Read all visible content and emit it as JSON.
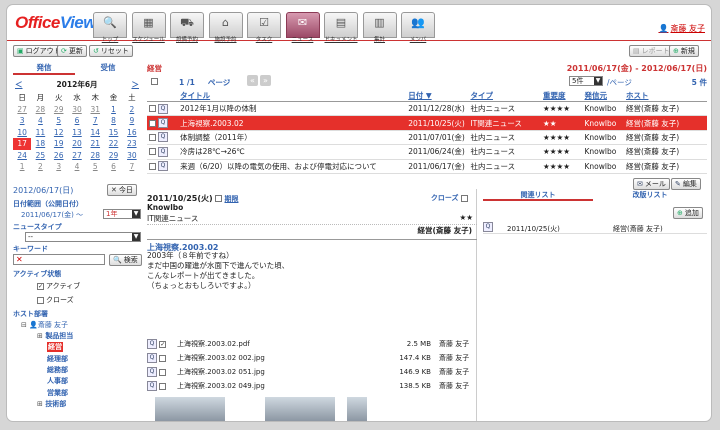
{
  "app": {
    "logo_a": "Office",
    "logo_b": "View"
  },
  "nav": [
    {
      "label": "トップ",
      "icon": "magnifier-icon"
    },
    {
      "label": "スケジュール",
      "icon": "calendar-icon"
    },
    {
      "label": "設備予約",
      "icon": "car-icon"
    },
    {
      "label": "施設予約",
      "icon": "building-icon"
    },
    {
      "label": "タスク",
      "icon": "checklist-icon"
    },
    {
      "label": "ニュース",
      "icon": "ticket-icon"
    },
    {
      "label": "ドキュメント",
      "icon": "document-icon"
    },
    {
      "label": "集計",
      "icon": "book-icon"
    },
    {
      "label": "メンバ",
      "icon": "members-icon"
    }
  ],
  "user": {
    "name": "斎藤 友子"
  },
  "toolbar": {
    "logout": "ログアウト",
    "refresh": "更新",
    "reset": "リセット",
    "report": "レポート",
    "new": "新規"
  },
  "left": {
    "tabs": [
      "発信",
      "受信"
    ],
    "calendar": {
      "prev": "＜",
      "next": "＞",
      "title": "2012年6月",
      "dow": [
        "日",
        "月",
        "火",
        "水",
        "木",
        "金",
        "土"
      ],
      "weeks": [
        [
          "27",
          "28",
          "29",
          "30",
          "31",
          "1",
          "2"
        ],
        [
          "3",
          "4",
          "5",
          "6",
          "7",
          "8",
          "9"
        ],
        [
          "10",
          "11",
          "12",
          "13",
          "14",
          "15",
          "16"
        ],
        [
          "17",
          "18",
          "19",
          "20",
          "21",
          "22",
          "23"
        ],
        [
          "24",
          "25",
          "26",
          "27",
          "28",
          "29",
          "30"
        ],
        [
          "1",
          "2",
          "3",
          "4",
          "5",
          "6",
          "7"
        ]
      ]
    },
    "selected_date": "2012/06/17(日)",
    "today_btn": "今日",
    "range_label": "日付範囲（公開日付）",
    "range_from": "2011/06/17(金) ～",
    "range_len": "1年",
    "newstype_label": "ニュースタイプ",
    "newstype_value": "--",
    "keyword_label": "キーワード",
    "search_btn": "検索",
    "active_label": "アクティブ状態",
    "active_opt": "アクティブ",
    "close_opt": "クローズ",
    "host_label": "ホスト部署",
    "host_user": "斎藤 友子",
    "tree": [
      "製品担当",
      "経営",
      "経理部",
      "総務部",
      "人事部",
      "営業部",
      "技術部"
    ]
  },
  "main": {
    "section": "経営",
    "date_range": "2011/06/17(金) - 2012/06/17(日)",
    "page_info": "1 /1",
    "page_word": "ページ",
    "per_page": "5件",
    "per_page_suffix": "/ページ",
    "count": "5 件",
    "headers": [
      "タイトル",
      "日付 ▼",
      "タイプ",
      "重要度",
      "発信元",
      "ホスト"
    ],
    "rows": [
      {
        "title": "2012年1月以降の体制",
        "date": "2011/12/28(水)",
        "type": "社内ニュース",
        "imp": "★★★★",
        "from": "Knowlbo",
        "host": "経営(斎藤 友子)"
      },
      {
        "title": "上海視察.2003.02",
        "date": "2011/10/25(火)",
        "type": "IT関連ニュース",
        "imp": "★★",
        "from": "Knowlbo",
        "host": "経営(斎藤 友子)"
      },
      {
        "title": "体制調整（2011年）",
        "date": "2011/07/01(金)",
        "type": "社内ニュース",
        "imp": "★★★★",
        "from": "Knowlbo",
        "host": "経営(斎藤 友子)"
      },
      {
        "title": "冷房は28℃→26℃",
        "date": "2011/06/24(金)",
        "type": "社内ニュース",
        "imp": "★★★★",
        "from": "Knowlbo",
        "host": "経営(斎藤 友子)"
      },
      {
        "title": "来週（6/20）以降の電気の使用、および停電対応について",
        "date": "2011/06/17(金)",
        "type": "社内ニュース",
        "imp": "★★★★",
        "from": "Knowlbo",
        "host": "経営(斎藤 友子)"
      }
    ],
    "mail_btn": "メール",
    "edit_btn": "編集"
  },
  "detail": {
    "date": "2011/10/25(火)",
    "deadline": "期限",
    "close": "クローズ",
    "from": "Knowlbo",
    "type": "IT関連ニュース",
    "imp": "★★",
    "host": "経営(斎藤 友子)",
    "title": "上海視察.2003.02",
    "body": [
      "2003年（８年前ですね）",
      "まだ中国の躍進が水面下で進んでいた頃、",
      "こんなレポートが出てきました。",
      "（ちょっとおもしろいですよ。）"
    ],
    "files": [
      {
        "name": "上海視察.2003.02.pdf",
        "size": "2.5 MB",
        "user": "斎藤 友子"
      },
      {
        "name": "上海視察.2003.02 002.jpg",
        "size": "147.4 KB",
        "user": "斎藤 友子"
      },
      {
        "name": "上海視察.2003.02 051.jpg",
        "size": "146.9 KB",
        "user": "斎藤 友子"
      },
      {
        "name": "上海視察.2003.02 049.jpg",
        "size": "138.5 KB",
        "user": "斎藤 友子"
      }
    ]
  },
  "related": {
    "tabs": [
      "関連リスト",
      "改版リスト"
    ],
    "add_btn": "追加",
    "entry_date": "2011/10/25(火)",
    "entry_host": "経営(斎藤 友子)"
  }
}
